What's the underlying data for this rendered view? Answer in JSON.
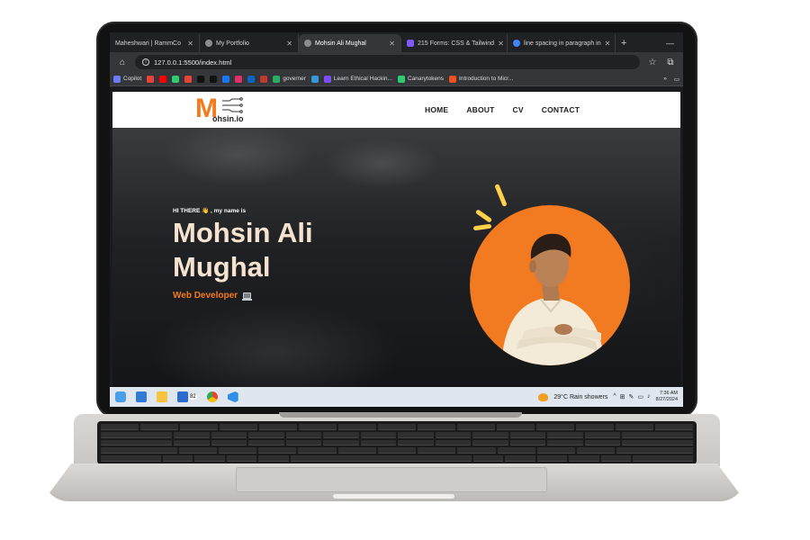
{
  "browser": {
    "tabs": [
      {
        "label": "Maheshwari | RammCo",
        "active": false
      },
      {
        "label": "My Portfolio",
        "active": false
      },
      {
        "label": "Mohsin Ali Mughal",
        "active": true
      },
      {
        "label": "215 Forms: CSS & Tailwind",
        "active": false
      },
      {
        "label": "line spacing in paragraph in",
        "active": false
      }
    ],
    "url": "127.0.0.1:5500/index.html",
    "bookmarks": [
      {
        "label": "Copilot",
        "color": "#6b7cff"
      },
      {
        "label": "",
        "color": "#ea4335"
      },
      {
        "label": "",
        "color": "#ff0000"
      },
      {
        "label": "",
        "color": "#2ecc71"
      },
      {
        "label": "",
        "color": "#ea4335"
      },
      {
        "label": "",
        "color": "#111111"
      },
      {
        "label": "",
        "color": "#111111"
      },
      {
        "label": "",
        "color": "#1877f2"
      },
      {
        "label": "",
        "color": "#e1306c"
      },
      {
        "label": "",
        "color": "#0a66c2"
      },
      {
        "label": "",
        "color": "#c0392b"
      },
      {
        "label": "governer",
        "color": "#27ae60"
      },
      {
        "label": "",
        "color": "#3498db"
      },
      {
        "label": "Learn Ethical Hackin...",
        "color": "#7c4dff"
      },
      {
        "label": "Canarytokens",
        "color": "#2ecc71"
      },
      {
        "label": "Introduction to Micr...",
        "color": "#f25022"
      }
    ]
  },
  "site": {
    "logo_letter": "M",
    "logo_text": "ohsin.io",
    "nav": [
      "HOME",
      "ABOUT",
      "CV",
      "CONTACT"
    ],
    "hero": {
      "greeting": "HI THERE 👋 , my name is",
      "name": "Mohsin Ali Mughal",
      "role": "Web Developer"
    },
    "accent": "#f47a1f"
  },
  "taskbar": {
    "badge": "82",
    "weather": "29°C  Rain showers",
    "time": "7:36 AM",
    "date": "8/27/2024"
  }
}
